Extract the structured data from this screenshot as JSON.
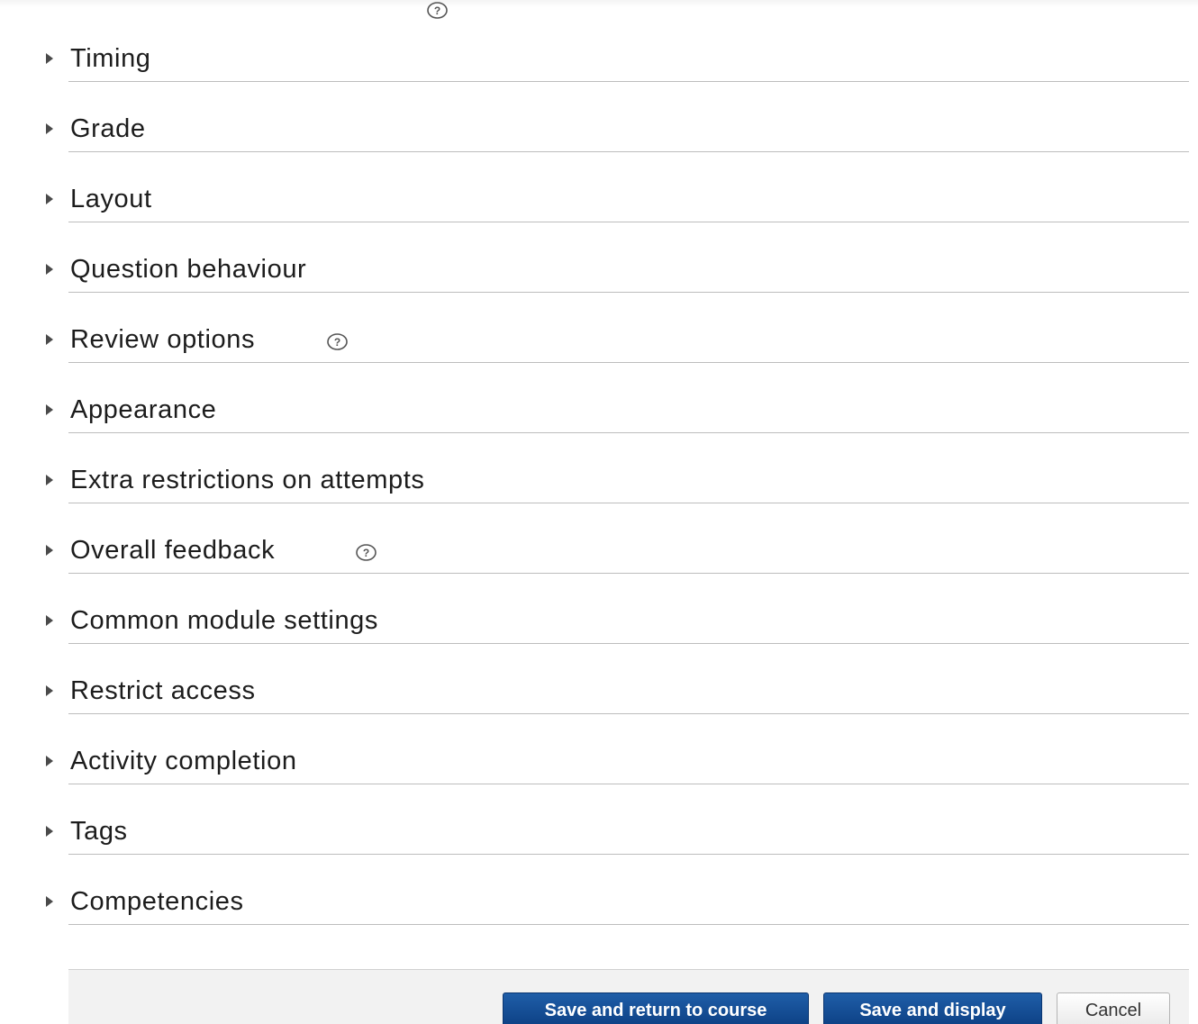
{
  "top_help_icon": "question-circle-icon",
  "sections": [
    {
      "label": "Timing",
      "has_help": false
    },
    {
      "label": "Grade",
      "has_help": false
    },
    {
      "label": "Layout",
      "has_help": false
    },
    {
      "label": "Question behaviour",
      "has_help": false
    },
    {
      "label": "Review options",
      "has_help": true
    },
    {
      "label": "Appearance",
      "has_help": false
    },
    {
      "label": "Extra restrictions on attempts",
      "has_help": false
    },
    {
      "label": "Overall feedback",
      "has_help": true
    },
    {
      "label": "Common module settings",
      "has_help": false
    },
    {
      "label": "Restrict access",
      "has_help": false
    },
    {
      "label": "Activity completion",
      "has_help": false
    },
    {
      "label": "Tags",
      "has_help": false
    },
    {
      "label": "Competencies",
      "has_help": false
    }
  ],
  "buttons": {
    "save_return": "Save and return to course",
    "save_display": "Save and display",
    "cancel": "Cancel"
  },
  "colors": {
    "primary_button": "#0f4a91",
    "divider": "#bdbdbd",
    "footer_bg": "#f2f2f2"
  }
}
